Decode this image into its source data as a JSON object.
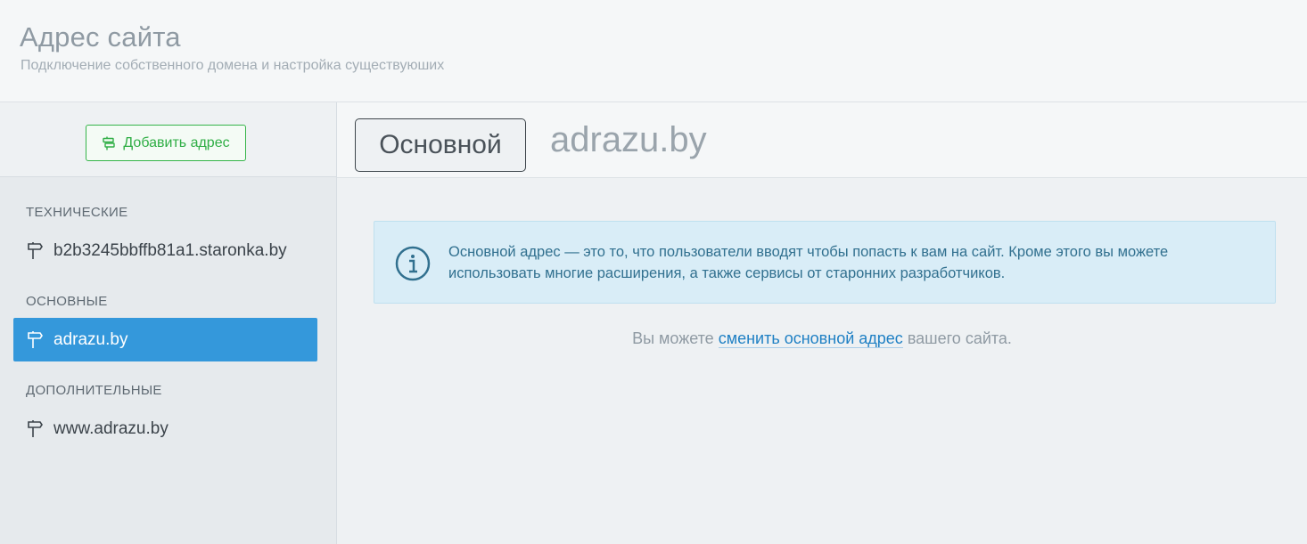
{
  "header": {
    "title": "Адрес сайта",
    "subtitle": "Подключение собственного домена и настройка существуюших"
  },
  "sidebar": {
    "add_button_label": "Добавить адрес",
    "groups": [
      {
        "label": "ТЕХНИЧЕСКИЕ",
        "items": [
          {
            "label": "b2b3245bbffb81a1.staronka.by",
            "active": false
          }
        ]
      },
      {
        "label": "ОСНОВНЫЕ",
        "items": [
          {
            "label": "adrazu.by",
            "active": true
          }
        ]
      },
      {
        "label": "ДОПОЛНИТЕЛЬНЫЕ",
        "items": [
          {
            "label": "www.adrazu.by",
            "active": false
          }
        ]
      }
    ]
  },
  "main": {
    "tag_label": "Основной",
    "domain": "adrazu.by",
    "info_text": "Основной адрес — это то, что пользователи вводят чтобы попасть к вам на сайт. Кроме этого вы можете использовать многие расширения, а также сервисы от старонних разработчиков.",
    "hint": {
      "prefix": "Вы можете",
      "link": "сменить основной адрес",
      "suffix": "вашего сайта."
    }
  },
  "icons": {
    "add_button": "signpost-icon",
    "domain_item": "signpost-icon",
    "info": "info-circle-icon"
  },
  "colors": {
    "accent": "#3498db",
    "success": "#35b449",
    "info_bg": "#d9edf7",
    "info_text": "#31708f",
    "link": "#1f80c4"
  }
}
